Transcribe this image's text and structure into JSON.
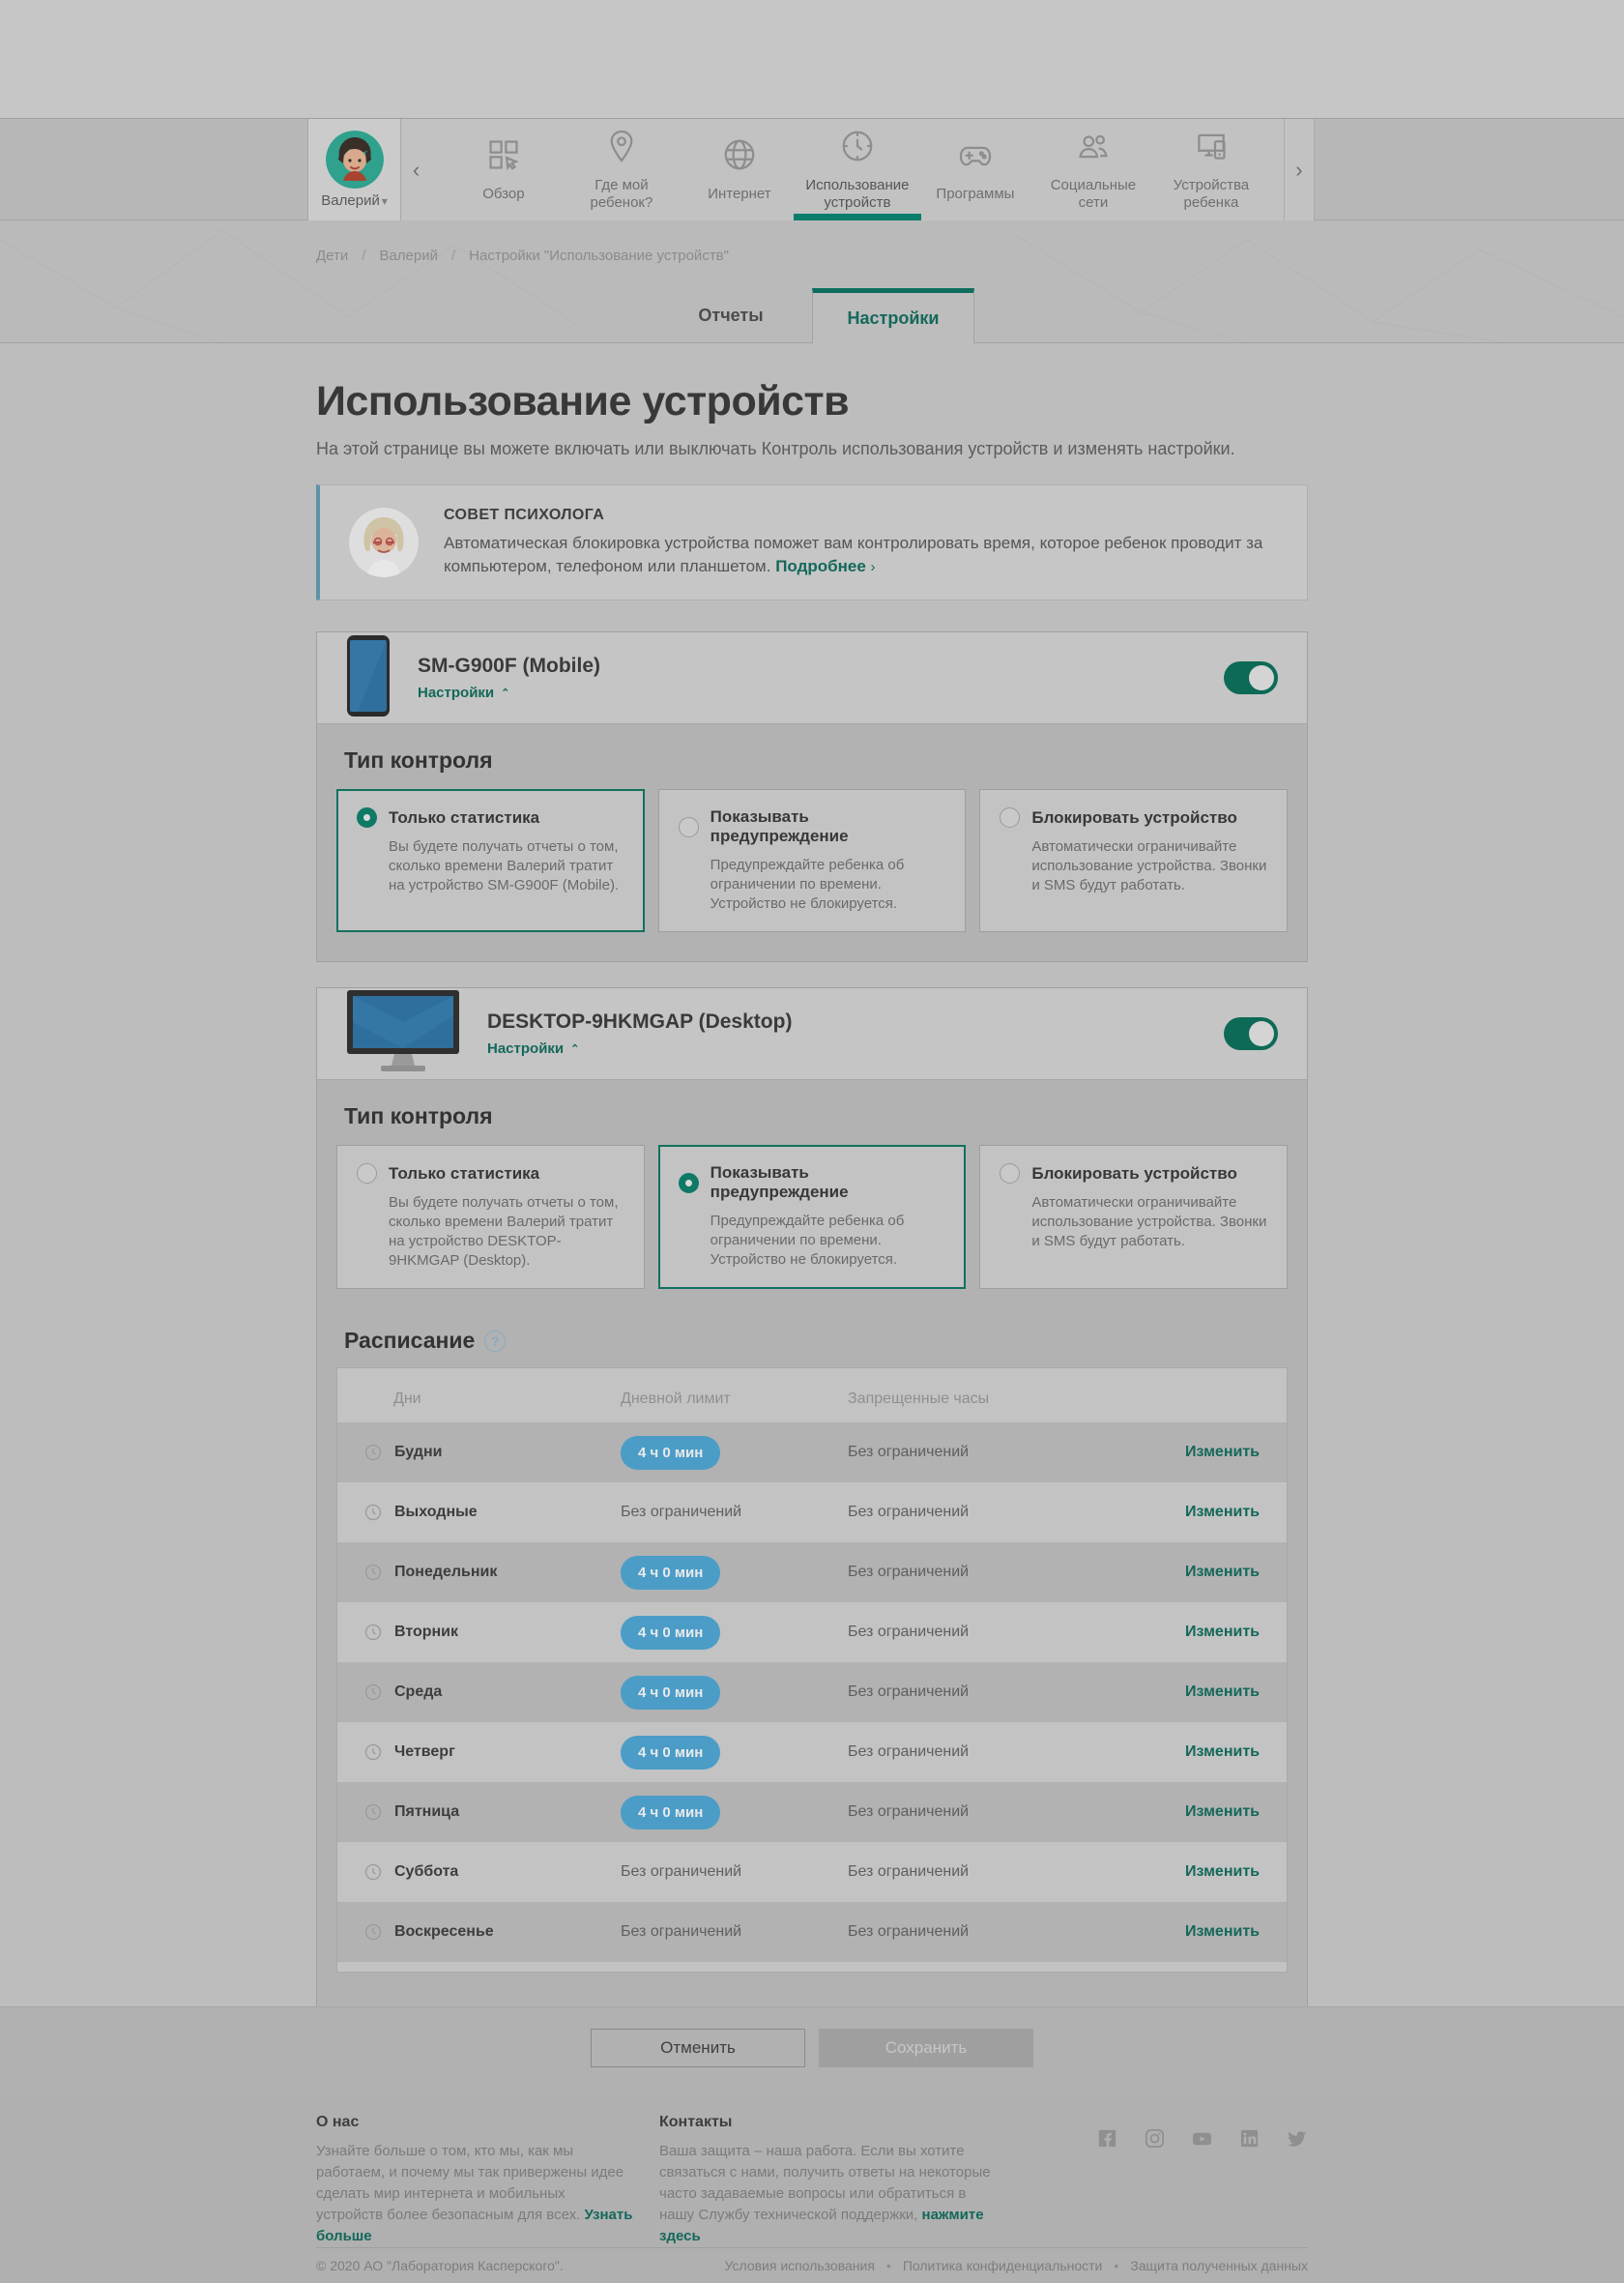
{
  "nav": {
    "child": {
      "name": "Валерий"
    },
    "items": [
      {
        "icon": "dashboard-icon",
        "label": "Обзор",
        "active": false
      },
      {
        "icon": "location-pin-icon",
        "label": "Где мой ребенок?",
        "active": false
      },
      {
        "icon": "globe-icon",
        "label": "Интернет",
        "active": false
      },
      {
        "icon": "clock-icon",
        "label": "Использование устройств",
        "active": true
      },
      {
        "icon": "gamepad-icon",
        "label": "Программы",
        "active": false
      },
      {
        "icon": "people-icon",
        "label": "Социальные сети",
        "active": false
      },
      {
        "icon": "devices-icon",
        "label": "Устройства ребенка",
        "active": false
      }
    ]
  },
  "breadcrumb": {
    "sep": "/",
    "items": [
      "Дети",
      "Валерий",
      "Настройки \"Использование устройств\""
    ]
  },
  "tabs": {
    "reports": "Отчеты",
    "settings": "Настройки"
  },
  "page": {
    "title": "Использование устройств",
    "subtitle": "На этой странице вы можете включать или выключать Контроль использования устройств и изменять настройки."
  },
  "advice": {
    "heading": "СОВЕТ ПСИХОЛОГА",
    "text": "Автоматическая блокировка устройства поможет вам контролировать время, которое ребенок проводит за компьютером, телефоном или планшетом.",
    "link": "Подробнее",
    "arrow": "›"
  },
  "control_title": "Тип контроля",
  "devices": [
    {
      "name": "SM-G900F (Mobile)",
      "settings_label": "Настройки",
      "enabled": true,
      "options": [
        {
          "title": "Только статистика",
          "desc": "Вы будете получать отчеты о том, сколько времени Валерий тратит на устройство SM-G900F (Mobile).",
          "selected": true
        },
        {
          "title": "Показывать предупреждение",
          "desc": "Предупреждайте ребенка об ограничении по времени. Устройство не блокируется.",
          "selected": false
        },
        {
          "title": "Блокировать устройство",
          "desc": "Автоматически ограничивайте использование устройства. Звонки и SMS будут работать.",
          "selected": false
        }
      ]
    },
    {
      "name": "DESKTOP-9HKMGAP (Desktop)",
      "settings_label": "Настройки",
      "enabled": true,
      "options": [
        {
          "title": "Только статистика",
          "desc": "Вы будете получать отчеты о том, сколько времени Валерий тратит на устройство DESKTOP-9HKMGAP (Desktop).",
          "selected": false
        },
        {
          "title": "Показывать предупреждение",
          "desc": "Предупреждайте ребенка об ограничении по времени. Устройство не блокируется.",
          "selected": true
        },
        {
          "title": "Блокировать устройство",
          "desc": "Автоматически ограничивайте использование устройства. Звонки и SMS будут работать.",
          "selected": false
        }
      ]
    }
  ],
  "schedule": {
    "title": "Расписание",
    "columns": {
      "days": "Дни",
      "limit": "Дневной лимит",
      "blocked": "Запрещенные часы"
    },
    "edit_label": "Изменить",
    "rows": [
      {
        "day": "Будни",
        "limit": "4 ч 0 мин",
        "limit_pill": true,
        "blocked": "Без ограничений"
      },
      {
        "day": "Выходные",
        "limit": "Без ограничений",
        "limit_pill": false,
        "blocked": "Без ограничений"
      },
      {
        "day": "Понедельник",
        "limit": "4 ч 0 мин",
        "limit_pill": true,
        "blocked": "Без ограничений"
      },
      {
        "day": "Вторник",
        "limit": "4 ч 0 мин",
        "limit_pill": true,
        "blocked": "Без ограничений"
      },
      {
        "day": "Среда",
        "limit": "4 ч 0 мин",
        "limit_pill": true,
        "blocked": "Без ограничений"
      },
      {
        "day": "Четверг",
        "limit": "4 ч 0 мин",
        "limit_pill": true,
        "blocked": "Без ограничений"
      },
      {
        "day": "Пятница",
        "limit": "4 ч 0 мин",
        "limit_pill": true,
        "blocked": "Без ограничений"
      },
      {
        "day": "Суббота",
        "limit": "Без ограничений",
        "limit_pill": false,
        "blocked": "Без ограничений"
      },
      {
        "day": "Воскресенье",
        "limit": "Без ограничений",
        "limit_pill": false,
        "blocked": "Без ограничений"
      }
    ]
  },
  "actions": {
    "cancel": "Отменить",
    "save": "Сохранить"
  },
  "footer": {
    "about": {
      "heading": "О нас",
      "text": "Узнайте больше о том, кто мы, как мы работаем, и почему мы так привержены идее сделать мир интернета и мобильных устройств более безопасным для всех.",
      "link": "Узнать больше"
    },
    "contacts": {
      "heading": "Контакты",
      "text": "Ваша защита – наша работа. Если вы хотите связаться с нами, получить ответы на некоторые часто задаваемые вопросы или обратиться в нашу Службу технической поддержки,",
      "link": "нажмите здесь"
    },
    "social_icons": [
      "facebook-icon",
      "instagram-icon",
      "youtube-icon",
      "linkedin-icon",
      "twitter-icon"
    ],
    "copyright": "© 2020 АО \"Лаборатория Касперского\".",
    "dot": "•",
    "legal_links": [
      "Условия использования",
      "Политика конфиденциальности",
      "Защита полученных данных"
    ]
  },
  "colors": {
    "accent_teal": "#0c7d6c",
    "pill_blue": "#4b9dc7",
    "advice_border": "#5d93a8"
  }
}
